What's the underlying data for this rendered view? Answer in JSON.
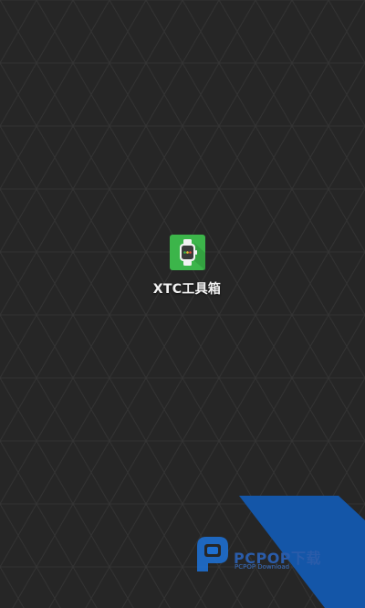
{
  "home": {
    "apps": [
      {
        "label": "XTC工具箱",
        "icon": "smartwatch-icon",
        "icon_bg": "#3cb54a"
      }
    ]
  },
  "watermark": {
    "brand_text": "PCPOP下载",
    "sub_text": "PCPOP Download",
    "color": "#1456a8"
  },
  "colors": {
    "background": "#262626"
  }
}
